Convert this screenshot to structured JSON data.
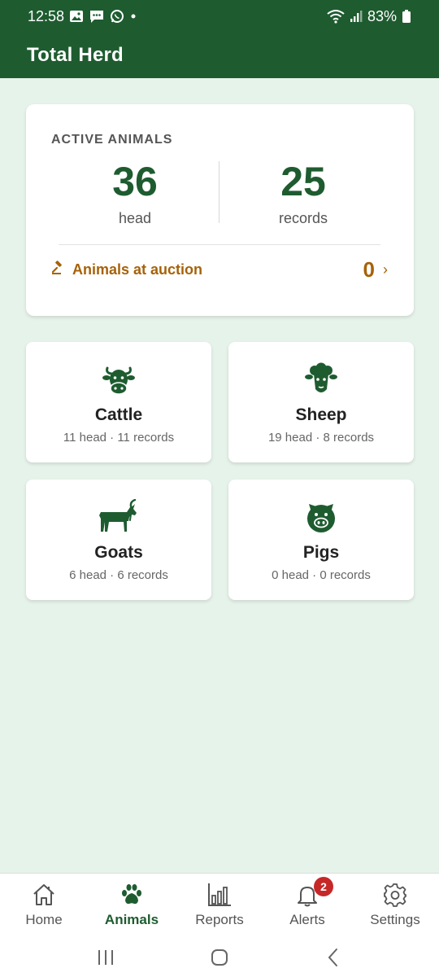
{
  "status_bar": {
    "time": "12:58",
    "battery": "83%",
    "icons_left": [
      "gallery-icon",
      "message-icon",
      "whatsapp-icon",
      "dot-icon"
    ],
    "icons_right": [
      "wifi-icon",
      "signal-icon",
      "battery-icon"
    ]
  },
  "app_bar": {
    "title": "Total Herd"
  },
  "summary": {
    "label": "ACTIVE ANIMALS",
    "head_count": "36",
    "head_label": "head",
    "record_count": "25",
    "record_label": "records",
    "auction_label": "Animals at auction",
    "auction_count": "0",
    "chevron": "›"
  },
  "animals": [
    {
      "name": "Cattle",
      "summary": "11 head · 11 records",
      "icon": "cattle-icon"
    },
    {
      "name": "Sheep",
      "summary": "19 head · 8 records",
      "icon": "sheep-icon"
    },
    {
      "name": "Goats",
      "summary": "6 head · 6 records",
      "icon": "goat-icon"
    },
    {
      "name": "Pigs",
      "summary": "0 head · 0 records",
      "icon": "pig-icon"
    }
  ],
  "bottom_nav": {
    "items": [
      {
        "label": "Home",
        "icon": "home-icon",
        "active": false
      },
      {
        "label": "Animals",
        "icon": "paw-icon",
        "active": true
      },
      {
        "label": "Reports",
        "icon": "bar-chart-icon",
        "active": false
      },
      {
        "label": "Alerts",
        "icon": "bell-icon",
        "active": false,
        "badge": "2"
      },
      {
        "label": "Settings",
        "icon": "gear-icon",
        "active": false
      }
    ]
  },
  "colors": {
    "primary": "#1e5c30",
    "background": "#e6f3ea",
    "accent": "#a6620a",
    "badge": "#c62828"
  }
}
